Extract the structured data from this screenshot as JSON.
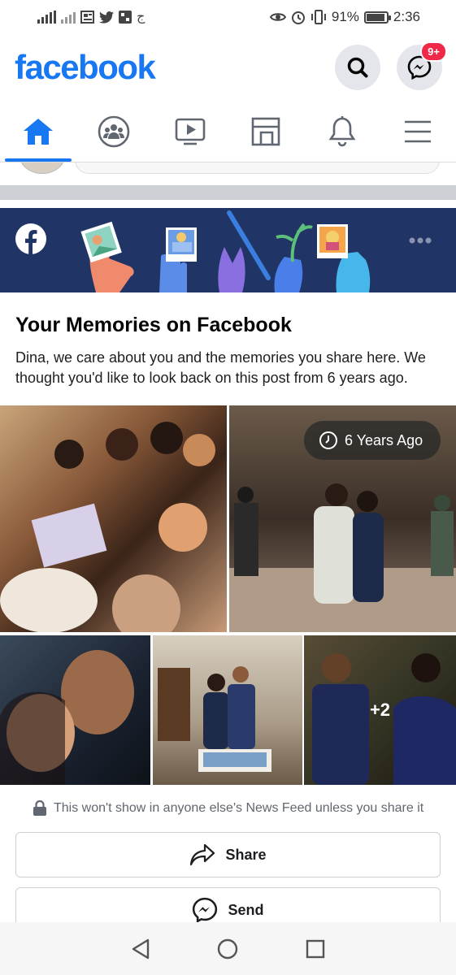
{
  "status_bar": {
    "battery_text": "91%",
    "battery_level": 0.91,
    "time": "2:36",
    "left_icons": [
      "signal-icon",
      "signal-x-icon",
      "news-icon",
      "twitter-icon",
      "app-icon",
      "arabic-char-icon"
    ],
    "right_icons": [
      "eye-icon",
      "alarm-icon",
      "vibrate-icon"
    ],
    "arabic_char": "ج"
  },
  "header": {
    "brand": "facebook",
    "brand_color": "#1877f2",
    "search_icon": "search-icon",
    "messenger_icon": "messenger-icon",
    "messenger_badge": "9+"
  },
  "nav_tabs": [
    {
      "icon": "home-icon",
      "active": true
    },
    {
      "icon": "groups-icon",
      "active": false
    },
    {
      "icon": "watch-icon",
      "active": false
    },
    {
      "icon": "marketplace-icon",
      "active": false
    },
    {
      "icon": "bell-icon",
      "active": false
    },
    {
      "icon": "menu-icon",
      "active": false
    }
  ],
  "memories_card": {
    "banner_color": "#213466",
    "title": "Your Memories on Facebook",
    "description": "Dina, we care about you and the memories you share here. We thought you'd like to look back on this post from 6 years ago.",
    "time_ago": "6 Years Ago",
    "photos": [
      {
        "name": "group-selfie-photo"
      },
      {
        "name": "party-hall-photo"
      },
      {
        "name": "couple-selfie-photo"
      },
      {
        "name": "couple-cake-photo"
      },
      {
        "name": "couple-dance-photo"
      }
    ],
    "more_count": "+2",
    "privacy_note": "This won't show in anyone else's News Feed unless you share it",
    "share_label": "Share",
    "send_label": "Send"
  },
  "android_nav": [
    "back-icon",
    "home-circle-icon",
    "recents-icon"
  ]
}
